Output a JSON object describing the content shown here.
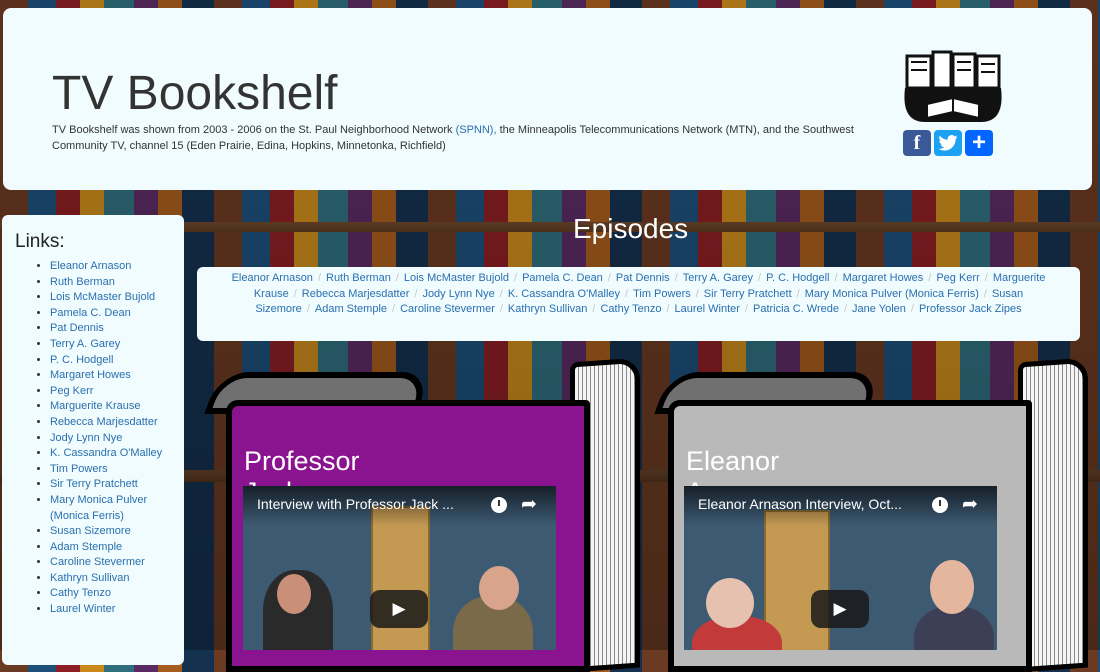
{
  "header": {
    "title": "TV Bookshelf",
    "description": "TV Bookshelf was shown from 2003 - 2006 on the St. Paul Neighborhood Network ",
    "spnn_link": "(SPNN),",
    "description_rest": " the Minneapolis Telecommunications Network (MTN), and the Southwest Community TV, channel 15 (Eden Prairie, Edina, Hopkins, Minnetonka, Richfield)",
    "share_buttons": [
      {
        "label": "f",
        "icon": "facebook-icon"
      },
      {
        "label": "t",
        "icon": "twitter-icon"
      },
      {
        "label": "+",
        "icon": "share-plus-icon"
      }
    ]
  },
  "sidebar": {
    "heading": "Links:",
    "links": [
      "Eleanor Arnason",
      "Ruth Berman",
      "Lois McMaster Bujold",
      "Pamela C. Dean",
      "Pat Dennis",
      "Terry A. Garey",
      "P. C. Hodgell",
      "Margaret Howes",
      "Peg Kerr",
      "Marguerite Krause",
      "Rebecca Marjesdatter",
      "Jody Lynn Nye",
      "K. Cassandra O'Malley",
      "Tim Powers",
      "Sir Terry Pratchett",
      "Mary Monica Pulver (Monica Ferris)",
      "Susan Sizemore",
      "Adam Stemple",
      "Caroline Stevermer",
      "Kathryn Sullivan",
      "Cathy Tenzo",
      "Laurel Winter"
    ]
  },
  "episodes": {
    "heading": "Episodes",
    "links": [
      "Eleanor Arnason",
      "Ruth Berman",
      "Lois McMaster Bujold",
      "Pamela C. Dean",
      "Pat Dennis",
      "Terry A. Garey",
      "P. C. Hodgell",
      "Margaret Howes",
      "Peg Kerr",
      "Marguerite Krause",
      "Rebecca Marjesdatter",
      "Jody Lynn Nye",
      "K. Cassandra O'Malley",
      "Tim Powers",
      "Sir Terry Pratchett",
      "Mary Monica Pulver (Monica Ferris)",
      "Susan Sizemore",
      "Adam Stemple",
      "Caroline Stevermer",
      "Kathryn Sullivan",
      "Cathy Tenzo",
      "Laurel Winter",
      "Patricia C. Wrede",
      "Jane Yolen",
      "Professor Jack Zipes"
    ],
    "separator": "/"
  },
  "books": [
    {
      "name": "Professor Jack Zipes",
      "cover_color": "#8a138f",
      "video_title": "Interview with Professor Jack ...",
      "icons": [
        "watch-later-icon",
        "share-icon",
        "play-icon"
      ]
    },
    {
      "name": "Eleanor Arnason",
      "cover_color": "#b9b9b9",
      "video_title": "Eleanor Arnason Interview, Oct...",
      "icons": [
        "watch-later-icon",
        "share-icon",
        "play-icon"
      ]
    }
  ],
  "glyphs": {
    "share_arrow": "➦",
    "play": "▶"
  }
}
